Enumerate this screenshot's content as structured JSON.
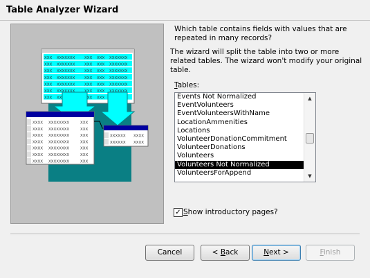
{
  "window": {
    "title": "Table Analyzer Wizard"
  },
  "content": {
    "question": "Which table contains fields with values that are repeated in many records?",
    "explanation": "The wizard will split the table into two or more related tables. The wizard won't modify your original table.",
    "tables_label_underlined": "T",
    "tables_label_rest": "ables:",
    "tables": [
      "Events Not Normalized",
      "EventVolunteers",
      "EventVolunteersWithName",
      "LocationAmmenities",
      "Locations",
      "VolunteerDonationCommitment",
      "VolunteerDonations",
      "Volunteers",
      "Volunteers Not Normalized",
      "VolunteersForAppend"
    ],
    "selected_table": "Volunteers Not Normalized",
    "checkbox_label_underlined": "S",
    "checkbox_label_rest": "how introductory pages?",
    "checkbox_checked": true
  },
  "illustration": {
    "cell_xxx": "XXX",
    "cell_xxxxxxx": "XXXXXXX",
    "cell_xxxx": "XXXX",
    "cell_xxxxxxxx": "XXXXXXXX",
    "cell_xxxxxx": "XXXXXX"
  },
  "buttons": {
    "cancel": "Cancel",
    "back_prefix": "< ",
    "back_underlined": "B",
    "back_rest": "ack",
    "next_underlined": "N",
    "next_rest": "ext >",
    "finish_underlined": "F",
    "finish_rest": "inish"
  },
  "colors": {
    "teal": "#0a7f84",
    "cyan": "#00ffff",
    "navy": "#0000a0",
    "selection": "#000000"
  }
}
